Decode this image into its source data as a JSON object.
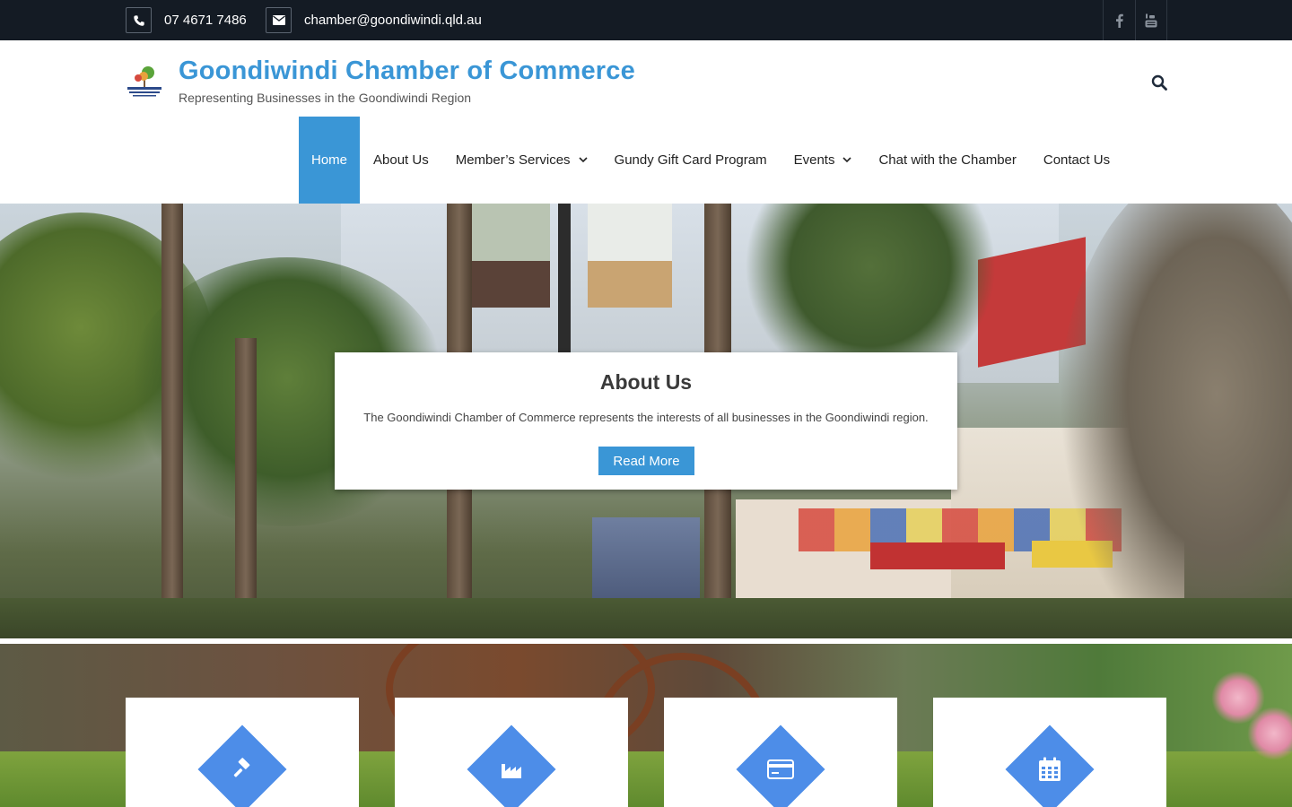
{
  "topbar": {
    "phone": "07 4671 7486",
    "email": "chamber@goondiwindi.qld.au",
    "phone_icon": "phone-icon",
    "email_icon": "envelope-icon",
    "social": [
      {
        "name": "facebook",
        "icon": "facebook-icon"
      },
      {
        "name": "youtube",
        "icon": "youtube-icon"
      }
    ]
  },
  "header": {
    "title": "Goondiwindi Chamber of Commerce",
    "tagline": "Representing Businesses in the Goondiwindi Region",
    "search_icon": "search-icon"
  },
  "nav": {
    "items": [
      {
        "label": "Home",
        "active": true,
        "dropdown": false
      },
      {
        "label": "About Us",
        "active": false,
        "dropdown": false
      },
      {
        "label": "Member’s Services",
        "active": false,
        "dropdown": true
      },
      {
        "label": "Gundy Gift Card Program",
        "active": false,
        "dropdown": false
      },
      {
        "label": "Events",
        "active": false,
        "dropdown": true
      },
      {
        "label": "Chat with the Chamber",
        "active": false,
        "dropdown": false
      },
      {
        "label": "Contact Us",
        "active": false,
        "dropdown": false
      }
    ]
  },
  "hero": {
    "card_title": "About Us",
    "card_text": "The Goondiwindi Chamber of Commerce represents the interests of all businesses in the Goondiwindi region.",
    "button_label": "Read More"
  },
  "features": [
    {
      "icon": "gavel-icon"
    },
    {
      "icon": "factory-icon"
    },
    {
      "icon": "credit-card-icon"
    },
    {
      "icon": "calendar-icon"
    }
  ],
  "colors": {
    "accent": "#3a96d6",
    "topbar_bg": "#141b24",
    "feature_diamond": "#4d8de8"
  }
}
